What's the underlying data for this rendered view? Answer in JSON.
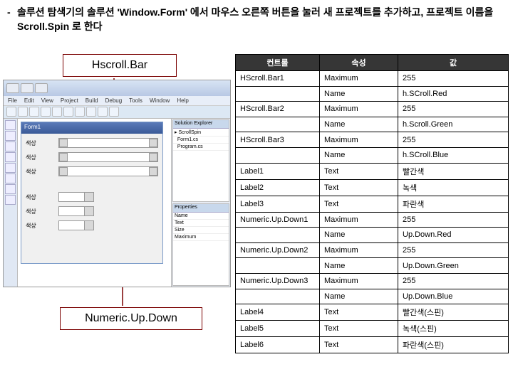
{
  "instruction": "솔루션 탐색기의 솔루션 'Window.Form' 에서 마우스 오른쪽 버튼을 눌러 새 프로젝트를 추가하고, 프로젝트 이름을 Scroll.Spin 로 한다",
  "callouts": {
    "top": "Hscroll.Bar",
    "bottom": "Numeric.Up.Down"
  },
  "screenshot": {
    "menus": [
      "File",
      "Edit",
      "View",
      "Project",
      "Build",
      "Debug",
      "Tools",
      "Window",
      "Help"
    ],
    "form_title": "Form1",
    "rows": {
      "hscroll_label": "색상",
      "updown_label": "색상"
    },
    "solution_panel": "Solution Explorer",
    "properties_panel": "Properties"
  },
  "table": {
    "headers": {
      "control": "컨트롤",
      "prop": "속성",
      "val": "값"
    },
    "rows": [
      {
        "c": "HScroll.Bar1",
        "p": "Maximum",
        "v": "255"
      },
      {
        "c": "",
        "p": "Name",
        "v": "h.SCroll.Red"
      },
      {
        "c": "HScroll.Bar2",
        "p": "Maximum",
        "v": "255"
      },
      {
        "c": "",
        "p": "Name",
        "v": "h.Scroll.Green"
      },
      {
        "c": "HScroll.Bar3",
        "p": "Maximum",
        "v": "255"
      },
      {
        "c": "",
        "p": "Name",
        "v": "h.SCroll.Blue"
      },
      {
        "c": "Label1",
        "p": "Text",
        "v": "빨간색"
      },
      {
        "c": "Label2",
        "p": "Text",
        "v": "녹색"
      },
      {
        "c": "Label3",
        "p": "Text",
        "v": "파란색"
      },
      {
        "c": "Numeric.Up.Down1",
        "p": "Maximum",
        "v": "255"
      },
      {
        "c": "",
        "p": "Name",
        "v": "Up.Down.Red"
      },
      {
        "c": "Numeric.Up.Down2",
        "p": "Maximum",
        "v": "255"
      },
      {
        "c": "",
        "p": "Name",
        "v": "Up.Down.Green"
      },
      {
        "c": "Numeric.Up.Down3",
        "p": "Maximum",
        "v": "255"
      },
      {
        "c": "",
        "p": "Name",
        "v": "Up.Down.Blue"
      },
      {
        "c": "Label4",
        "p": "Text",
        "v": "빨간색(스핀)"
      },
      {
        "c": "Label5",
        "p": "Text",
        "v": "녹색(스핀)"
      },
      {
        "c": "Label6",
        "p": "Text",
        "v": "파란색(스핀)"
      }
    ]
  }
}
